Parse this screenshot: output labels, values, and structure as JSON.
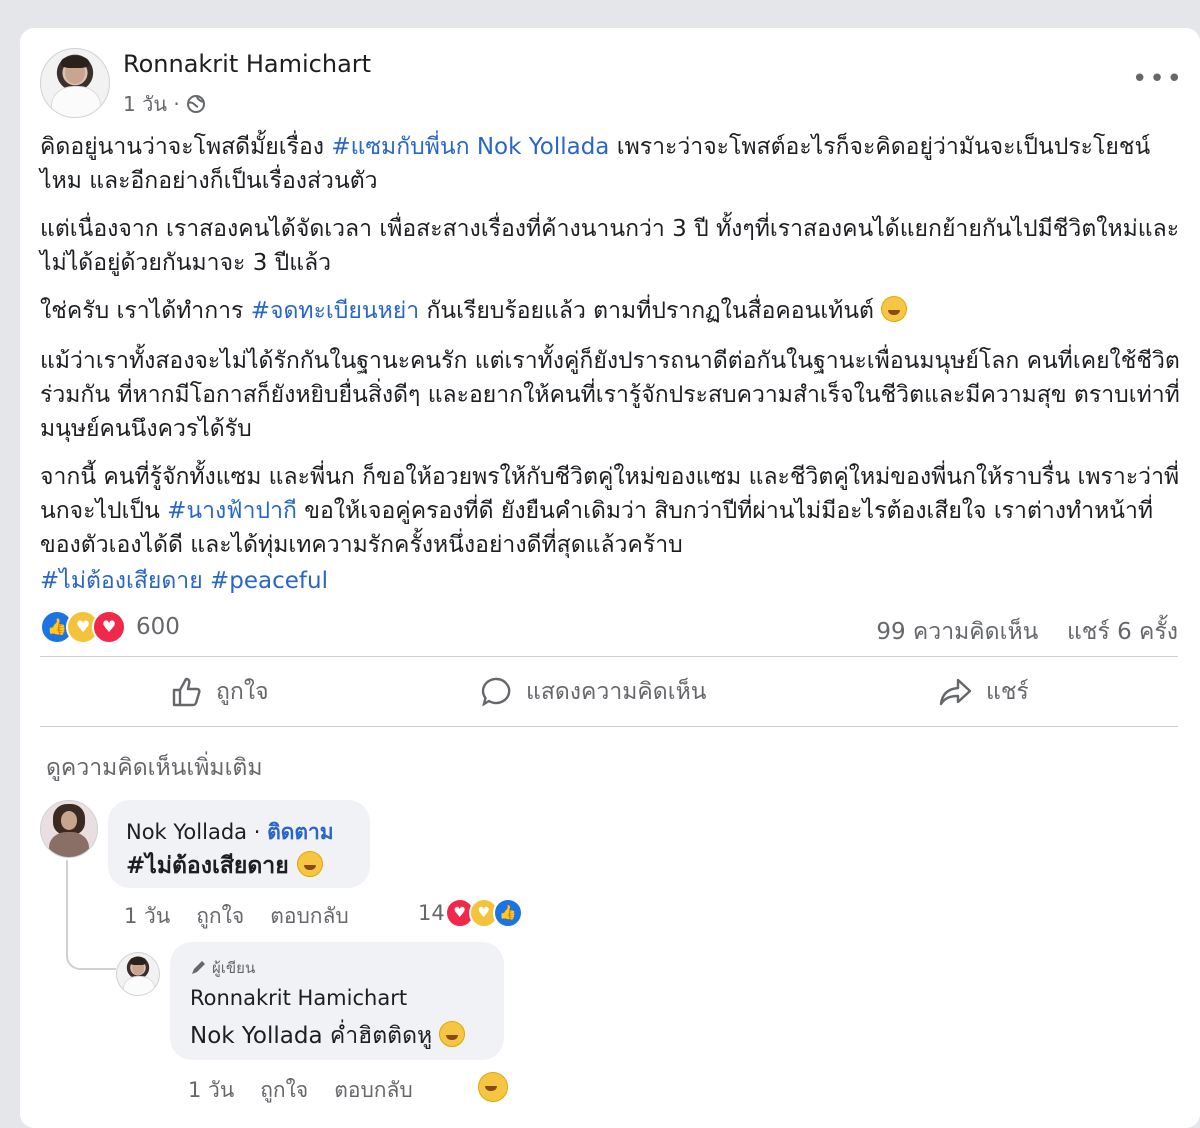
{
  "post": {
    "author": "Ronnakrit Hamichart",
    "time": "1 วัน ·",
    "more_label": "•••",
    "paragraph1": {
      "a": "คิดอยู่นานว่าจะโพสดีมั้ยเรื่อง ",
      "tag": "#แซมกับพี่นก Nok Yollada",
      "b": " เพราะว่าจะโพสต์อะไรก็จะคิดอยู่ว่ามันจะเป็นประโยชน์ไหม และอีกอย่างก็เป็นเรื่องส่วนตัว"
    },
    "paragraph2": "แต่เนื่องจาก เราสองคนได้จัดเวลา เพื่อสะสางเรื่องที่ค้างนานกว่า 3 ปี ทั้งๆที่เราสองคนได้แยกย้ายกันไปมีชีวิตใหม่และไม่ได้อยู่ด้วยกันมาจะ 3 ปีแล้ว",
    "paragraph3": {
      "a": "ใช่ครับ เราได้ทำการ ",
      "tag": "#จดทะเบียนหย่า",
      "b": " กันเรียบร้อยแล้ว ตามที่ปรากฏในสื่อคอนเท้นต์ "
    },
    "paragraph4": "แม้ว่าเราทั้งสองจะไม่ได้รักกันในฐานะคนรัก แต่เราทั้งคู่ก็ยังปรารถนาดีต่อกันในฐานะเพื่อนมนุษย์โลก คนที่เคยใช้ชีวิตร่วมกัน ที่หากมีโอกาสก็ยังหยิบยื่นสิ่งดีๆ และอยากให้คนที่เรารู้จักประสบความสำเร็จในชีวิตและมีความสุข ตราบเท่าที่มนุษย์คนนึงควรได้รับ",
    "paragraph5": {
      "a": "จากนี้ คนที่รู้จักทั้งแซม และพี่นก ก็ขอให้อวยพรให้กับชีวิตคู่ใหม่ของแซม และชีวิตคู่ใหม่ของพี่นกให้ราบรื่น เพราะว่าพี่นกจะไปเป็น ",
      "tag": "#นางฟ้าปากี",
      "b": " ขอให้เจอคู่ครองที่ดี ยังยืนคำเดิมว่า สิบกว่าปีที่ผ่านไม่มีอะไรต้องเสียใจ เราต่างทำหน้าที่ของตัวเองได้ดี และได้ทุ่มเทความรักครั้งหนึ่งอย่างดีที่สุดแล้วคร้าบ"
    },
    "hashtags": "#ไม่ต้องเสียดาย #peaceful",
    "reaction_count": "600",
    "comments_count": "99 ความคิดเห็น",
    "shares_count": "แชร์ 6 ครั้ง",
    "actions": {
      "like": "ถูกใจ",
      "comment": "แสดงความคิดเห็น",
      "share": "แชร์"
    }
  },
  "comments_section": {
    "more_comments": "ดูความคิดเห็นเพิ่มเติม",
    "comment1": {
      "name": "Nok Yollada",
      "separator": " · ",
      "follow": "ติดตาม",
      "text": "#ไม่ต้องเสียดาย ",
      "time": "1 วัน",
      "like": "ถูกใจ",
      "reply": "ตอบกลับ",
      "reaction_count": "14"
    },
    "reply1": {
      "badge": "ผู้เขียน",
      "name": "Ronnakrit Hamichart",
      "text": "Nok Yollada ค่ำฮิตติดหู ",
      "time": "1 วัน",
      "like": "ถูกใจ",
      "reply": "ตอบกลับ"
    }
  },
  "colors": {
    "accent": "#2866c9",
    "like_blue": "#1b74e4",
    "love_red": "#f0284a",
    "care_yellow": "#f5c33b"
  }
}
